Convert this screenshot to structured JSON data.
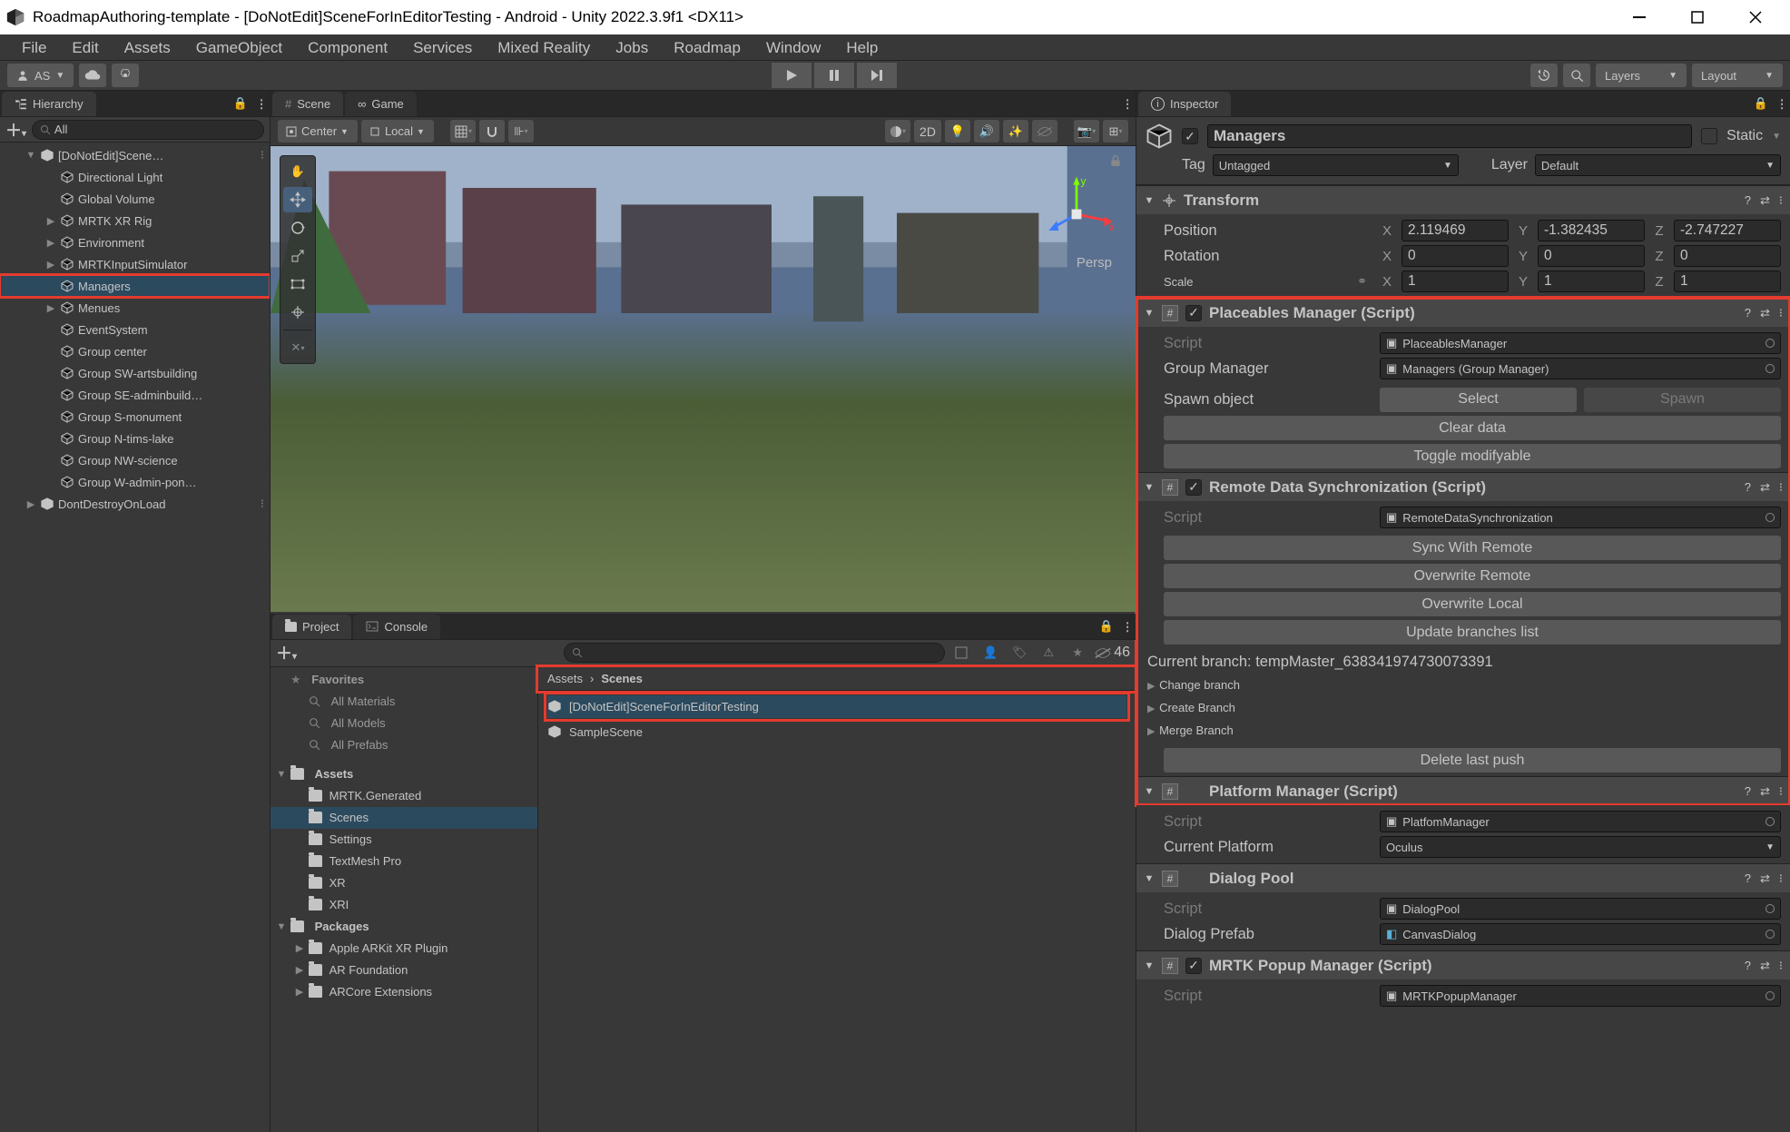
{
  "window": {
    "title": "RoadmapAuthoring-template - [DoNotEdit]SceneForInEditorTesting - Android - Unity 2022.3.9f1 <DX11>"
  },
  "menu": [
    "File",
    "Edit",
    "Assets",
    "GameObject",
    "Component",
    "Services",
    "Mixed Reality",
    "Jobs",
    "Roadmap",
    "Window",
    "Help"
  ],
  "topbar": {
    "account": "AS",
    "layers": "Layers",
    "layout": "Layout"
  },
  "hierarchy": {
    "tab": "Hierarchy",
    "search_placeholder": "All",
    "items": [
      {
        "indent": 1,
        "fold": "▼",
        "name": "[DoNotEdit]Scene…",
        "unity": true
      },
      {
        "indent": 2,
        "name": "Directional Light"
      },
      {
        "indent": 2,
        "name": "Global Volume"
      },
      {
        "indent": 2,
        "fold": "▶",
        "name": "MRTK XR Rig"
      },
      {
        "indent": 2,
        "fold": "▶",
        "name": "Environment"
      },
      {
        "indent": 2,
        "fold": "▶",
        "name": "MRTKInputSimulator"
      },
      {
        "indent": 2,
        "name": "Managers",
        "sel": true,
        "hl": true
      },
      {
        "indent": 2,
        "fold": "▶",
        "name": "Menues"
      },
      {
        "indent": 2,
        "name": "EventSystem"
      },
      {
        "indent": 2,
        "name": "Group center"
      },
      {
        "indent": 2,
        "name": "Group SW-artsbuilding"
      },
      {
        "indent": 2,
        "name": "Group SE-adminbuild…"
      },
      {
        "indent": 2,
        "name": "Group S-monument"
      },
      {
        "indent": 2,
        "name": "Group N-tims-lake"
      },
      {
        "indent": 2,
        "name": "Group NW-science"
      },
      {
        "indent": 2,
        "name": "Group W-admin-pon…"
      },
      {
        "indent": 1,
        "fold": "▶",
        "name": "DontDestroyOnLoad",
        "unity": true
      }
    ]
  },
  "scene": {
    "tabs": [
      "Scene",
      "Game"
    ],
    "pivot": "Center",
    "space": "Local",
    "persp": "Persp",
    "_2d": "2D"
  },
  "project": {
    "tabs": [
      "Project",
      "Console"
    ],
    "favorites_label": "Favorites",
    "favorites": [
      "All Materials",
      "All Models",
      "All Prefabs"
    ],
    "assets_label": "Assets",
    "asset_folders": [
      "MRTK.Generated",
      "Scenes",
      "Settings",
      "TextMesh Pro",
      "XR",
      "XRI"
    ],
    "packages_label": "Packages",
    "packages": [
      "Apple ARKit XR Plugin",
      "AR Foundation",
      "ARCore Extensions"
    ],
    "count": "46",
    "breadcrumb": [
      "Assets",
      "Scenes"
    ],
    "assets": [
      "[DoNotEdit]SceneForInEditorTesting",
      "SampleScene"
    ]
  },
  "inspector": {
    "tab": "Inspector",
    "go_name": "Managers",
    "static": "Static",
    "tag_label": "Tag",
    "tag": "Untagged",
    "layer_label": "Layer",
    "layer": "Default",
    "transform": {
      "title": "Transform",
      "pos": "Position",
      "rot": "Rotation",
      "scale": "Scale",
      "px": "2.119469",
      "py": "-1.382435",
      "pz": "-2.747227",
      "rx": "0",
      "ry": "0",
      "rz": "0",
      "sx": "1",
      "sy": "1",
      "sz": "1"
    },
    "placeables": {
      "title": "Placeables Manager (Script)",
      "script_label": "Script",
      "script": "PlaceablesManager",
      "gm_label": "Group Manager",
      "gm": "Managers (Group Manager)",
      "spawn_label": "Spawn object",
      "select": "Select",
      "spawn": "Spawn",
      "clear": "Clear data",
      "toggle": "Toggle modifyable"
    },
    "remote": {
      "title": "Remote Data Synchronization (Script)",
      "script": "RemoteDataSynchronization",
      "sync": "Sync With Remote",
      "over_r": "Overwrite Remote",
      "over_l": "Overwrite Local",
      "update": "Update branches list",
      "branch_txt": "Current branch: tempMaster_638341974730073391",
      "change": "Change branch",
      "create": "Create Branch",
      "merge": "Merge Branch",
      "delete": "Delete last push"
    },
    "platform": {
      "title": "Platform Manager (Script)",
      "script": "PlatfomManager",
      "cur_label": "Current Platform",
      "cur": "Oculus"
    },
    "dialog": {
      "title": "Dialog Pool",
      "script": "DialogPool",
      "prefab_label": "Dialog Prefab",
      "prefab": "CanvasDialog"
    },
    "popup": {
      "title": "MRTK Popup Manager (Script)",
      "script": "MRTKPopupManager"
    },
    "script_label": "Script"
  }
}
